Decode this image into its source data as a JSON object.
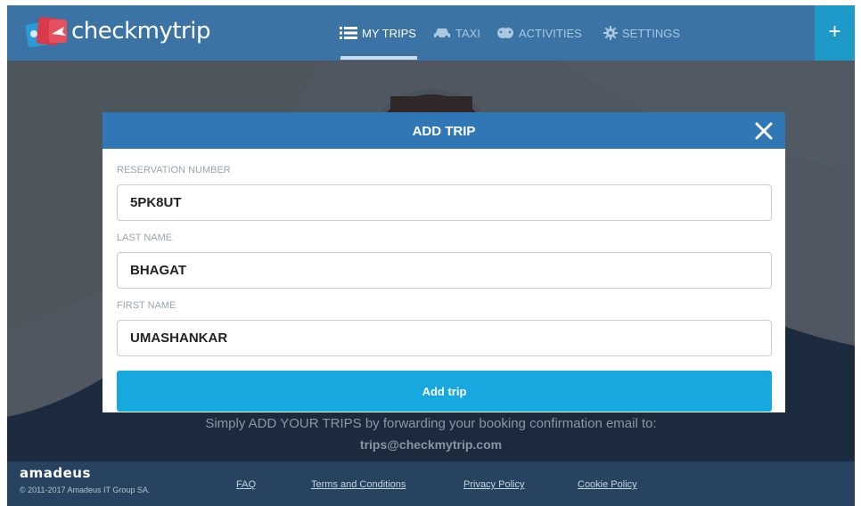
{
  "brand": {
    "name": "checkmytrip"
  },
  "nav": {
    "items": [
      {
        "label": "MY TRIPS",
        "icon": "list-icon",
        "active": true
      },
      {
        "label": "TAXI",
        "icon": "car-icon"
      },
      {
        "label": "ACTIVITIES",
        "icon": "masks-icon"
      },
      {
        "label": "SETTINGS",
        "icon": "gear-icon"
      }
    ],
    "add_label": "+"
  },
  "modal": {
    "title": "ADD TRIP",
    "fields": [
      {
        "label": "RESERVATION NUMBER",
        "value": "5PK8UT"
      },
      {
        "label": "LAST NAME",
        "value": "BHAGAT"
      },
      {
        "label": "FIRST NAME",
        "value": "UMASHANKAR"
      }
    ],
    "submit_label": "Add trip"
  },
  "info": {
    "text": "Simply ADD YOUR TRIPS by forwarding your booking confirmation email to:",
    "email": "trips@checkmytrip.com"
  },
  "footer": {
    "brand": "amadeus",
    "copyright": "© 2011-2017 Amadeus IT Group SA.",
    "links": [
      "FAQ",
      "Terms and Conditions",
      "Privacy Policy",
      "Cookie Policy"
    ]
  },
  "colors": {
    "nav": "#3b73a4",
    "modal_header": "#3077b5",
    "submit": "#17a8df",
    "footer": "#27435f"
  }
}
